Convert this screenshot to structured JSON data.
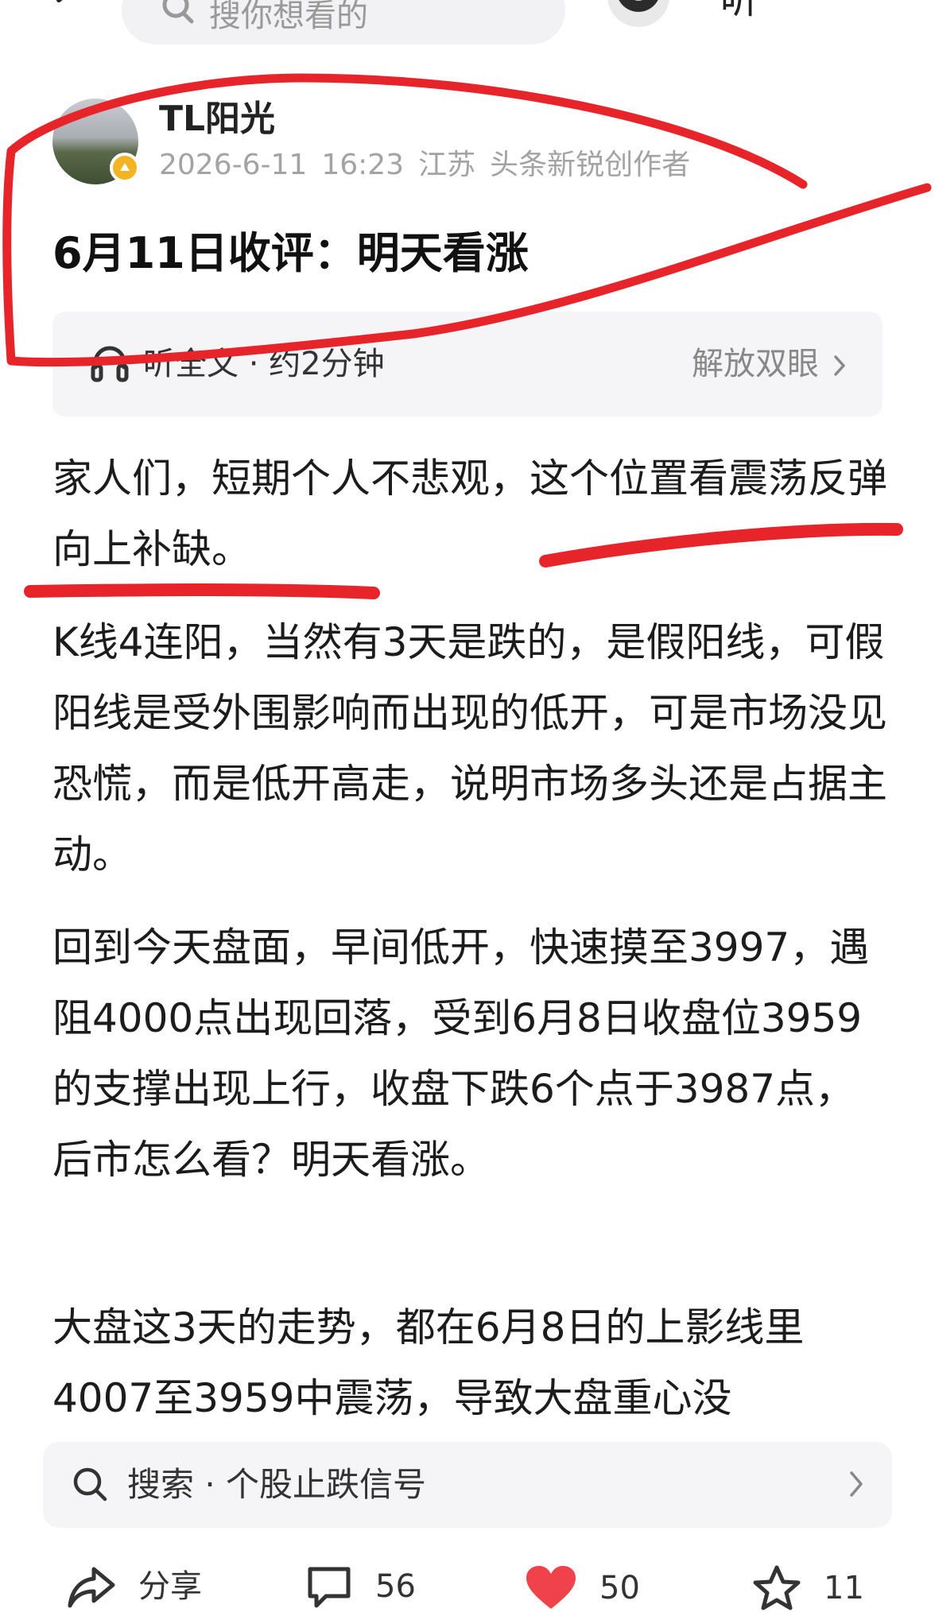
{
  "header": {
    "search_placeholder": "搜你想看的",
    "listen_label": "听"
  },
  "author": {
    "name": "TL阳光",
    "date": "2026-6-11",
    "time": "16:23",
    "location": "江苏",
    "tag": "头条新锐创作者"
  },
  "article": {
    "title": "6月11日收评：明天看涨",
    "listen_text": "听全文 · 约2分钟",
    "free_eyes_label": "解放双眼",
    "paragraphs": [
      "家人们，短期个人不悲观，这个位置看震荡反弹向上补缺。",
      "K线4连阳，当然有3天是跌的，是假阳线，可假阳线是受外围影响而出现的低开，可是市场没见恐慌，而是低开高走，说明市场多头还是占据主动。",
      "回到今天盘面，早间低开，快速摸至3997，遇阻4000点出现回落，受到6月8日收盘位3959的支撑出现上行，收盘下跌6个点于3987点，后市怎么看？明天看涨。",
      "大盘这3天的走势，都在6月8日的上影线里4007至3959中震荡，导致大盘重心没"
    ]
  },
  "bottom_search": {
    "text": "搜索 · 个股止跌信号"
  },
  "actions": {
    "share_label": "分享",
    "comment_count": "56",
    "like_count": "50",
    "favorite_count": "11"
  },
  "colors": {
    "annotation_red": "#e8242b",
    "like_red": "#f0424a",
    "meta_gray": "#a3a3a3",
    "badge_gold": "#f4b323"
  }
}
